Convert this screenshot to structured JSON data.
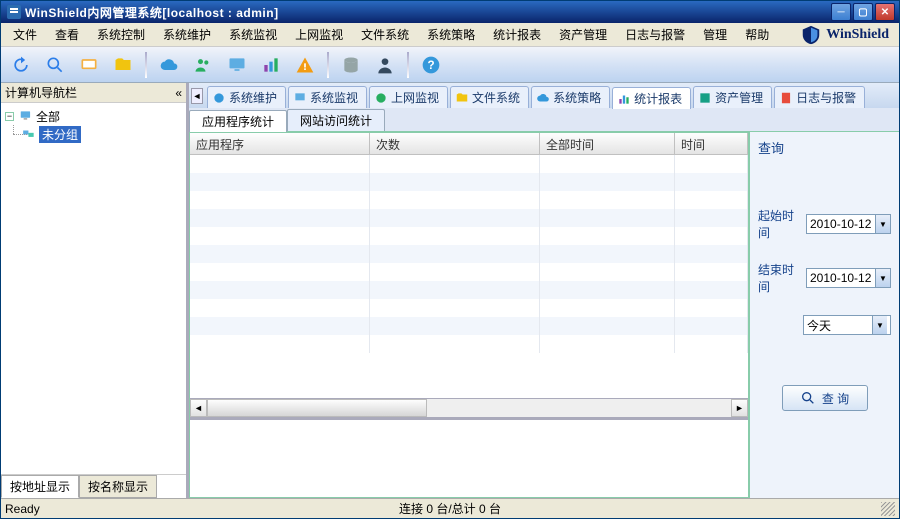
{
  "titlebar": {
    "text": "WinShield内网管理系统[localhost : admin]"
  },
  "brand": "WinShield",
  "menu": {
    "items": [
      "文件",
      "查看",
      "系统控制",
      "系统维护",
      "系统监视",
      "上网监视",
      "文件系统",
      "系统策略",
      "统计报表",
      "资产管理",
      "日志与报警",
      "管理",
      "帮助"
    ]
  },
  "sidebar": {
    "title": "计算机导航栏",
    "nodes": {
      "root": "全部",
      "child": "未分组"
    },
    "bottomTabs": [
      "按地址显示",
      "按名称显示"
    ]
  },
  "modtabs": [
    "系统维护",
    "系统监视",
    "上网监视",
    "文件系统",
    "系统策略",
    "统计报表",
    "资产管理",
    "日志与报警"
  ],
  "modtabsActive": 5,
  "subtabs": [
    "应用程序统计",
    "网站访问统计"
  ],
  "grid": {
    "cols": [
      "应用程序",
      "次数",
      "全部时间",
      "时间"
    ]
  },
  "query": {
    "title": "查询",
    "start_label": "起始时间",
    "start_value": "2010-10-12",
    "end_label": "结束时间",
    "end_value": "2010-10-12",
    "range_value": "今天",
    "button": "查 询"
  },
  "status": {
    "left": "Ready",
    "center": "连接 0 台/总计 0 台"
  }
}
